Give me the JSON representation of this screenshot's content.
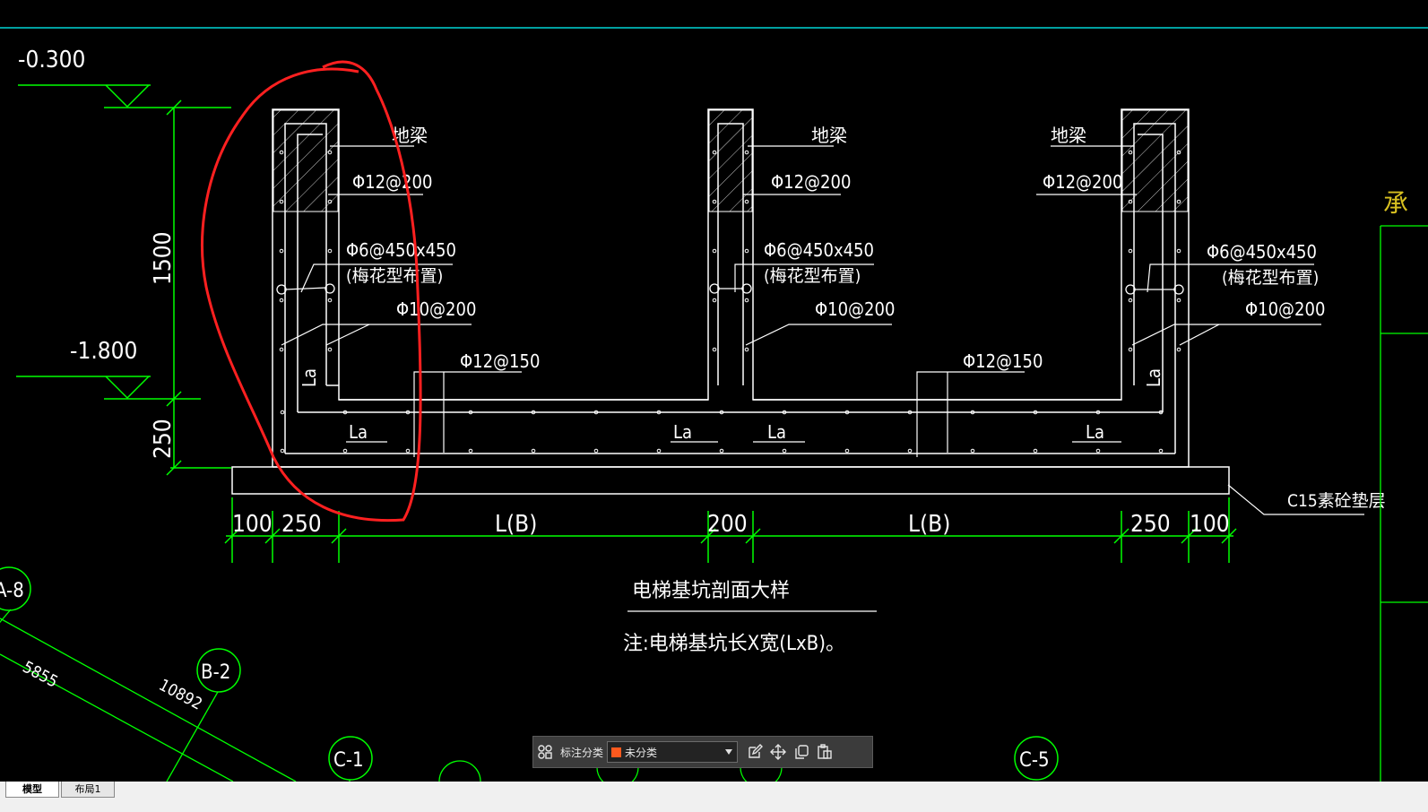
{
  "drawing": {
    "elevations": {
      "top": "-0.300",
      "bottom": "-1.800"
    },
    "vertical_dims": {
      "wall": "1500",
      "slab": "250"
    },
    "beam_label": "地梁",
    "rebar": {
      "beam_top": "Φ12@200",
      "tie": "Φ6@450x450",
      "tie_note": "(梅花型布置)",
      "wall": "Φ10@200",
      "slab": "Φ12@150",
      "anchor": "La"
    },
    "bottom_dims": [
      "100",
      "250",
      "L(B)",
      "200",
      "L(B)",
      "250",
      "100"
    ],
    "cushion_note": "C15素砼垫层",
    "title": "电梯基坑剖面大样",
    "note": "注:电梯基坑长X宽(LxB)。",
    "grid_bubbles": [
      "A-8",
      "B-2",
      "C-1",
      "C-5"
    ],
    "lengths": [
      "5855",
      "10892"
    ],
    "right_edge_text": "承"
  },
  "annotation_bar": {
    "label": "标注分类",
    "selected": "未分类",
    "swatch_color": "#ff5a1e",
    "icons": [
      "grid-icon",
      "edit-icon",
      "move-icon",
      "copy-icon",
      "paste-icon"
    ]
  },
  "layout_tabs": {
    "model": "模型",
    "layout1": "布局1"
  },
  "colors": {
    "background": "#000000",
    "lines": "#ffffff",
    "dims": "#00ff00",
    "markup": "#ff2020",
    "titlebar_line": "#00a0a0"
  }
}
